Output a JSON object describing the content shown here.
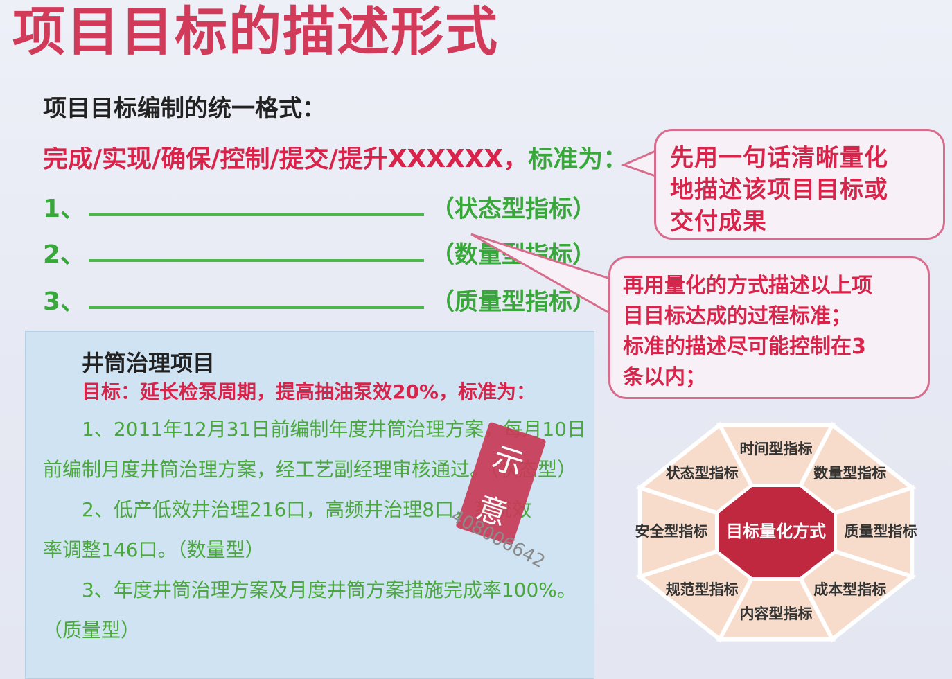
{
  "slide": {
    "title": "项目目标的描述形式",
    "subtitle": "项目目标编制的统一格式：",
    "format_red": "完成/实现/确保/控制/提交/提升XXXXXX，",
    "format_green": "标准为：",
    "items": [
      {
        "num": "1、",
        "type": "（状态型指标）"
      },
      {
        "num": "2、",
        "type": "（数量型指标）"
      },
      {
        "num": "3、",
        "type": "（质量型指标）"
      }
    ]
  },
  "callouts": {
    "first": [
      "先用一句话清晰量化",
      "地描述该项目目标或",
      "交付成果"
    ],
    "second": [
      "再用量化的方式描述以上项",
      "目目标达成的过程标准；",
      "标准的描述尽可能控制在3",
      "条以内；"
    ]
  },
  "example": {
    "title": "井筒治理项目",
    "goal": "目标：延长检泵周期，提高抽油泵效20%，标准为：",
    "lines": [
      "1、2011年12月31日前编制年度井筒治理方案，每月10日",
      "前编制月度井筒治理方案，经工艺副经理审核通过。（状态型）",
      "2、低产低效井治理216口，高频井治理8口，系统效",
      "率调整146口。（数量型）",
      "3、年度井筒治理方案及月度井筒方案措施完成率100%。",
      "（质量型）"
    ]
  },
  "stamp": {
    "chars": [
      "示",
      "意"
    ],
    "id": "408006642"
  },
  "diagram": {
    "center": "目标量化方式",
    "segments": [
      "时间型指标",
      "数量型指标",
      "质量型指标",
      "成本型指标",
      "内容型指标",
      "规范型指标",
      "安全型指标",
      "状态型指标"
    ],
    "colors": {
      "segment": "#f7dccb",
      "border": "#ffffff",
      "center": "#c0283f"
    }
  }
}
